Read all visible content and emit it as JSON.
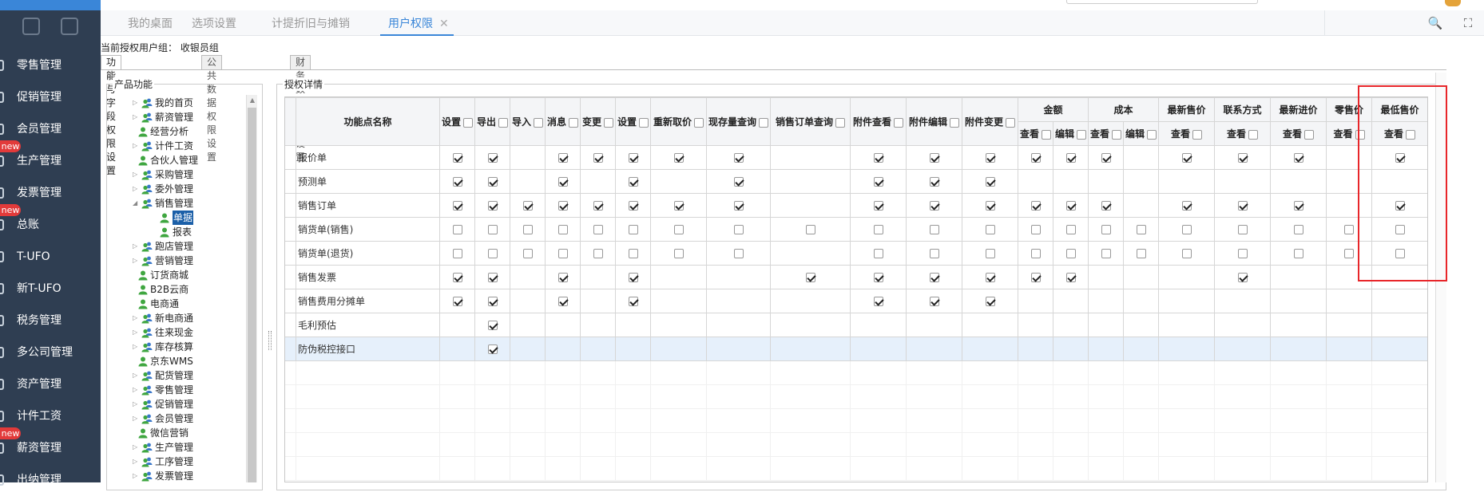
{
  "sidebar": {
    "items": [
      {
        "label": "零售管理",
        "badge": ""
      },
      {
        "label": "促销管理",
        "badge": ""
      },
      {
        "label": "会员管理",
        "badge": ""
      },
      {
        "label": "生产管理",
        "badge": "new"
      },
      {
        "label": "发票管理",
        "badge": ""
      },
      {
        "label": "总账",
        "badge": "new"
      },
      {
        "label": "T-UFO",
        "badge": ""
      },
      {
        "label": "新T-UFO",
        "badge": ""
      },
      {
        "label": "税务管理",
        "badge": ""
      },
      {
        "label": "多公司管理",
        "badge": ""
      },
      {
        "label": "资产管理",
        "badge": ""
      },
      {
        "label": "计件工资",
        "badge": ""
      },
      {
        "label": "薪资管理",
        "badge": "new"
      },
      {
        "label": "出纳管理",
        "badge": ""
      }
    ]
  },
  "tabs": [
    {
      "label": "我的桌面"
    },
    {
      "label": "选项设置"
    },
    {
      "label": "计提折旧与摊销"
    },
    {
      "label": "用户权限",
      "close": "✕"
    }
  ],
  "toolbar": {
    "search_icon": "🔍",
    "fullscreen_icon": "⛶"
  },
  "group": {
    "label": "当前授权用户组： 收银员组"
  },
  "subtabs": [
    "功能与字段权限设置",
    "公共数据权限设置",
    "财务数据权限设置"
  ],
  "tree": {
    "legend": "产品功能",
    "items": [
      {
        "label": "我的首页",
        "type": "group"
      },
      {
        "label": "薪资管理",
        "type": "group"
      },
      {
        "label": "经营分析",
        "type": "leaf"
      },
      {
        "label": "计件工资",
        "type": "group"
      },
      {
        "label": "合伙人管理",
        "type": "leaf"
      },
      {
        "label": "采购管理",
        "type": "group"
      },
      {
        "label": "委外管理",
        "type": "group"
      },
      {
        "label": "销售管理",
        "type": "open"
      },
      {
        "label": "单据",
        "type": "child",
        "selected": true
      },
      {
        "label": "报表",
        "type": "child"
      },
      {
        "label": "跑店管理",
        "type": "group"
      },
      {
        "label": "营销管理",
        "type": "group"
      },
      {
        "label": "订货商城",
        "type": "leaf"
      },
      {
        "label": "B2B云商",
        "type": "leaf"
      },
      {
        "label": "电商通",
        "type": "leaf"
      },
      {
        "label": "新电商通",
        "type": "group"
      },
      {
        "label": "往来现金",
        "type": "group"
      },
      {
        "label": "库存核算",
        "type": "group"
      },
      {
        "label": "京东WMS",
        "type": "leaf"
      },
      {
        "label": "配货管理",
        "type": "group"
      },
      {
        "label": "零售管理",
        "type": "group"
      },
      {
        "label": "促销管理",
        "type": "group"
      },
      {
        "label": "会员管理",
        "type": "group"
      },
      {
        "label": "微信营销",
        "type": "leaf"
      },
      {
        "label": "生产管理",
        "type": "group"
      },
      {
        "label": "工序管理",
        "type": "group"
      },
      {
        "label": "发票管理",
        "type": "group"
      }
    ]
  },
  "grid": {
    "legend": "授权详情",
    "name_header": "功能点名称",
    "simple_cols": [
      "设置",
      "导出",
      "导入",
      "消息",
      "变更",
      "设置",
      "重新取价",
      "现存量查询",
      "销售订单查询",
      "附件查看",
      "附件编辑",
      "附件变更"
    ],
    "group_cols": [
      {
        "label": "金额",
        "subs": [
          "查看",
          "编辑"
        ]
      },
      {
        "label": "成本",
        "subs": [
          "查看",
          "编辑"
        ]
      },
      {
        "label": "最新售价",
        "subs": [
          "查看"
        ]
      },
      {
        "label": "联系方式",
        "subs": [
          "查看"
        ]
      },
      {
        "label": "最新进价",
        "subs": [
          "查看"
        ]
      },
      {
        "label": "零售价",
        "subs": [
          "查看"
        ]
      },
      {
        "label": "最低售价",
        "subs": [
          "查看"
        ]
      }
    ],
    "rows": [
      {
        "name": "报价单",
        "cells": [
          1,
          1,
          0,
          1,
          1,
          1,
          1,
          1,
          0,
          1,
          1,
          1,
          1,
          1,
          1,
          0,
          1,
          1,
          1,
          0,
          1
        ]
      },
      {
        "name": "预测单",
        "cells": [
          1,
          1,
          0,
          1,
          0,
          1,
          0,
          1,
          0,
          1,
          1,
          1,
          0,
          0,
          0,
          0,
          0,
          0,
          0,
          0,
          0
        ]
      },
      {
        "name": "销售订单",
        "cells": [
          1,
          1,
          1,
          1,
          1,
          1,
          1,
          1,
          0,
          1,
          1,
          1,
          1,
          1,
          1,
          0,
          1,
          1,
          1,
          0,
          1
        ]
      },
      {
        "name": "销货单(销售)",
        "cells": [
          2,
          2,
          2,
          2,
          2,
          2,
          2,
          2,
          2,
          2,
          2,
          2,
          2,
          2,
          2,
          2,
          2,
          2,
          2,
          2,
          2
        ]
      },
      {
        "name": "销货单(退货)",
        "cells": [
          2,
          2,
          2,
          2,
          2,
          2,
          2,
          2,
          0,
          2,
          2,
          2,
          2,
          2,
          2,
          2,
          2,
          2,
          2,
          2,
          2
        ]
      },
      {
        "name": "销售发票",
        "cells": [
          1,
          1,
          0,
          1,
          0,
          1,
          0,
          0,
          1,
          1,
          1,
          1,
          1,
          1,
          0,
          0,
          0,
          1,
          0,
          0,
          0
        ]
      },
      {
        "name": "销售费用分摊单",
        "cells": [
          1,
          1,
          0,
          1,
          0,
          1,
          0,
          0,
          0,
          1,
          1,
          1,
          0,
          0,
          0,
          0,
          0,
          0,
          0,
          0,
          0
        ]
      },
      {
        "name": "毛利预估",
        "cells": [
          0,
          1,
          0,
          0,
          0,
          0,
          0,
          0,
          0,
          0,
          0,
          0,
          0,
          0,
          0,
          0,
          0,
          0,
          0,
          0,
          0
        ]
      },
      {
        "name": "防伪税控接口",
        "cells": [
          0,
          1,
          0,
          0,
          0,
          0,
          0,
          0,
          0,
          0,
          0,
          0,
          0,
          0,
          0,
          0,
          0,
          0,
          0,
          0,
          0
        ]
      }
    ]
  },
  "colors": {
    "sidebar_bg": "#2f3e52",
    "accent": "#3a86d8",
    "badge": "#e23a3a",
    "highlight_box": "#e8262a",
    "selected_tree": "#1b5fa8"
  }
}
